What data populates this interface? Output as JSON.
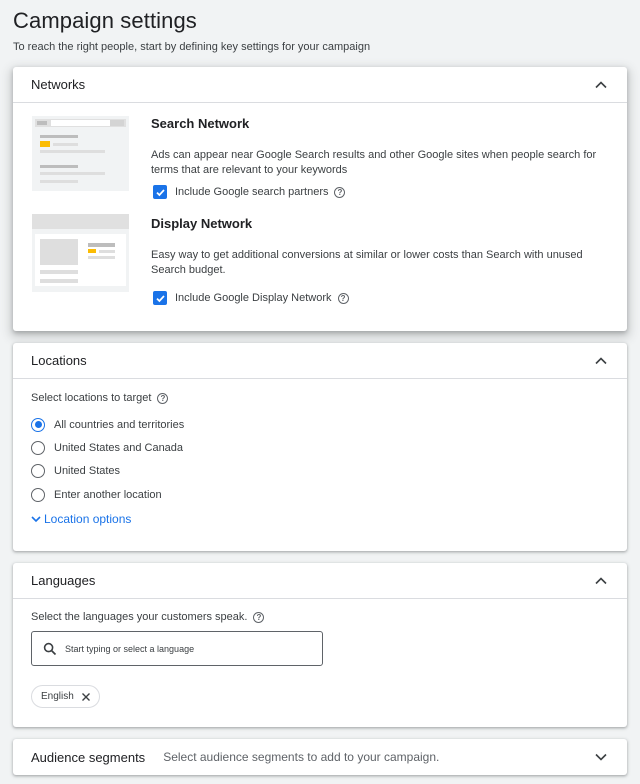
{
  "page": {
    "title": "Campaign settings",
    "subtitle": "To reach the right people, start by defining key settings for your campaign"
  },
  "networks": {
    "title": "Networks",
    "search": {
      "title": "Search Network",
      "description": "Ads can appear near Google Search results and other Google sites when people search for terms that are relevant to your keywords",
      "checkbox_label": "Include Google search partners",
      "checked": true
    },
    "display": {
      "title": "Display Network",
      "description": "Easy way to get additional conversions at similar or lower costs than Search with unused Search budget.",
      "checkbox_label": "Include Google Display Network",
      "checked": true
    }
  },
  "locations": {
    "title": "Locations",
    "prompt": "Select locations to target",
    "options": [
      {
        "label": "All countries and territories",
        "selected": true
      },
      {
        "label": "United States and Canada",
        "selected": false
      },
      {
        "label": "United States",
        "selected": false
      },
      {
        "label": "Enter another location",
        "selected": false
      }
    ],
    "more_link": "Location options"
  },
  "languages": {
    "title": "Languages",
    "prompt": "Select the languages your customers speak.",
    "search_placeholder": "Start typing or select a language",
    "selected": [
      "English"
    ]
  },
  "audience": {
    "title": "Audience segments",
    "description": "Select audience segments to add to your campaign."
  },
  "colors": {
    "accent": "#1a73e8",
    "highlight": "#fbbc04",
    "background": "#f1f3f4"
  },
  "icons": [
    "chevron-up-icon",
    "chevron-down-icon",
    "help-icon",
    "check-icon",
    "search-icon",
    "close-icon"
  ]
}
